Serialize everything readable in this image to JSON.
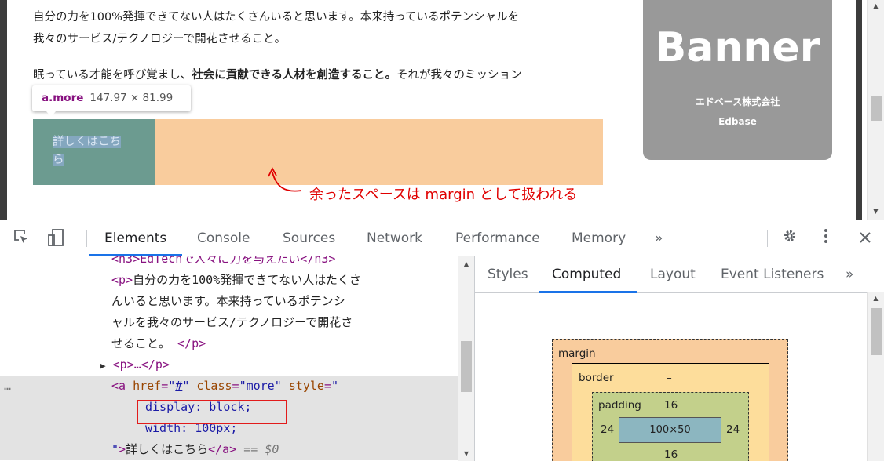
{
  "page": {
    "paragraph1_line1": "自分の力を100%発揮できてない人はたくさんいると思います。本来持っているポテンシャルを",
    "paragraph1_line2": "我々のサービス/テクノロジーで開花させること。",
    "paragraph2_a": "眠っている才能を呼び覚まし、",
    "paragraph2_b": "社会に貢献できる人材を創造すること。",
    "paragraph2_c": "それが我々のミッション",
    "more_link_line1": "詳しくはこち",
    "more_link_line2": "ら",
    "annotation": "余ったスペースは margin として扱われる",
    "banner": {
      "title": "Banner",
      "company": "エドベース株式会社",
      "company_en": "Edbase"
    }
  },
  "tooltip": {
    "selector": "a.more",
    "dimensions": "147.97 × 81.99"
  },
  "devtools": {
    "tabs": [
      "Elements",
      "Console",
      "Sources",
      "Network",
      "Performance",
      "Memory"
    ],
    "more_tabs": "»",
    "elements": {
      "line0": "<h3>EdTechで人々に力を与えたい</h3>",
      "line1_tag": "<p>",
      "line1_text": "自分の力を100%発揮できてない人はたくさ",
      "line2": "んいると思います。本来持っているポテンシ",
      "line3": "ャルを我々のサービス/テクノロジーで開花さ",
      "line4_text": "せること。",
      "line4_tag": "</p>",
      "line5": "<p>…</p>",
      "line6_open": "<a",
      "line6_attr1": "href",
      "line6_val1": "#",
      "line6_attr2": "class",
      "line6_val2": "more",
      "line6_attr3": "style",
      "line7": "display: block;",
      "line8": "width: 100px;",
      "line9_text": "詳しくはこちら",
      "line9_tag": "</a>",
      "line9_eq": "== $0",
      "dots": "…"
    },
    "sidebar_tabs": [
      "Styles",
      "Computed",
      "Layout",
      "Event Listeners"
    ],
    "sidebar_more": "»",
    "box_model": {
      "margin_label": "margin",
      "margin_value": "–",
      "border_label": "border",
      "border_value": "–",
      "padding_label": "padding",
      "padding_top": "16",
      "padding_left": "24",
      "padding_right": "24",
      "padding_bottom": "16",
      "content": "100×50",
      "left_outer": "–",
      "left_inner": "–",
      "right_inner": "–",
      "right_outer": "–"
    },
    "icons": [
      "inspect-icon",
      "device-toggle-icon",
      "settings-gear-icon",
      "kebab-menu-icon",
      "close-icon"
    ]
  }
}
